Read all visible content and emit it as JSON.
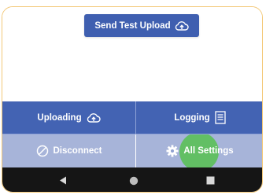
{
  "top": {
    "send_test_upload_label": "Send Test Upload"
  },
  "grid": {
    "uploading_label": "Uploading",
    "logging_label": "Logging",
    "disconnect_label": "Disconnect",
    "all_settings_label": "All Settings"
  },
  "icons": {
    "send_test_upload": "cloud-upload-icon",
    "uploading": "cloud-upload-icon",
    "logging": "log-document-icon",
    "disconnect": "disconnect-icon",
    "settings": "gear-icon",
    "nav_back": "back-icon",
    "nav_home": "home-icon",
    "nav_recents": "recents-icon"
  },
  "colors": {
    "primary": "#4363b3",
    "disabled": "#a7b4d9",
    "ripple": "#5cc05a",
    "navbar": "#151515",
    "frame": "#f3c877"
  }
}
